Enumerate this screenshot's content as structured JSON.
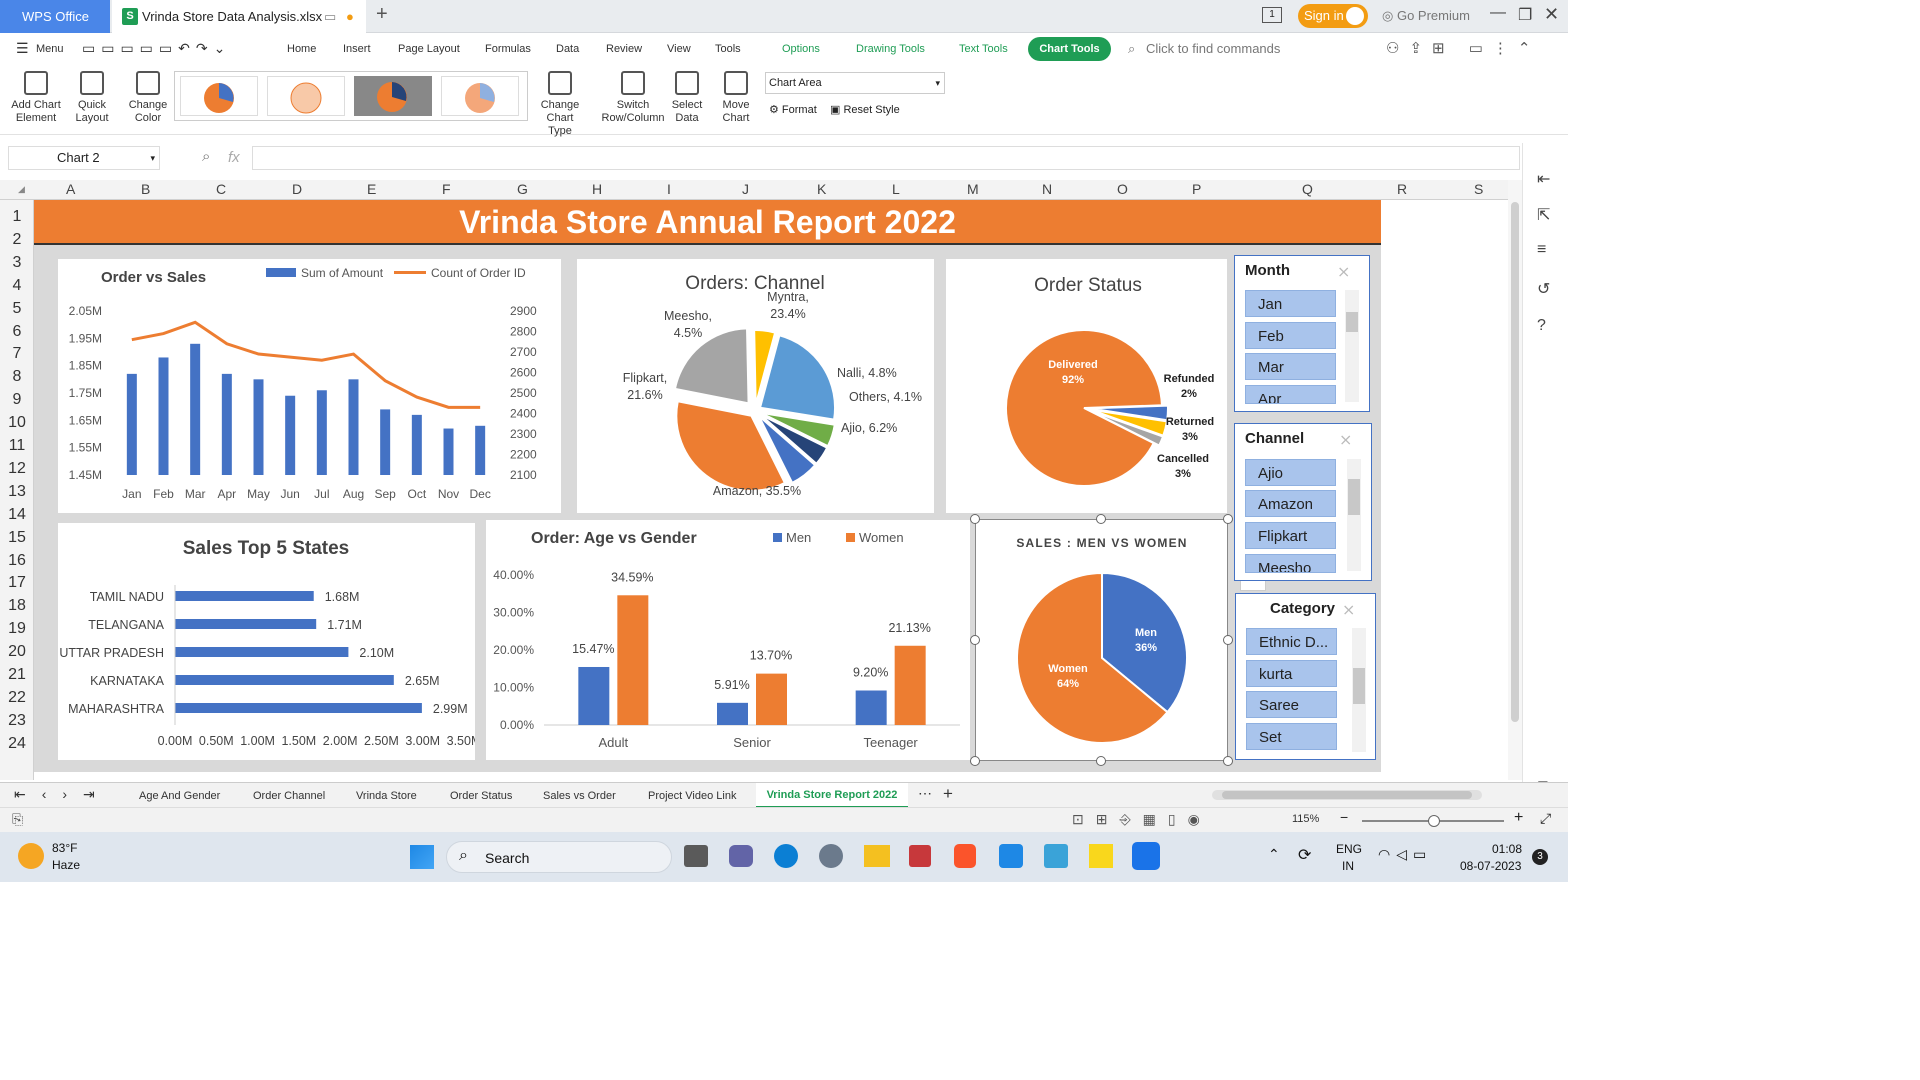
{
  "titlebar": {
    "app": "WPS Office",
    "file": "Vrinda Store Data Analysis.xlsx",
    "sign_in": "Sign in",
    "premium": "Go Premium"
  },
  "menu": {
    "menu_label": "Menu",
    "items": [
      "Home",
      "Insert",
      "Page Layout",
      "Formulas",
      "Data",
      "Review",
      "View",
      "Tools"
    ],
    "ctx": [
      "Options",
      "Drawing Tools",
      "Text Tools"
    ],
    "active": "Chart Tools",
    "search": "Click to find commands"
  },
  "ribbon": {
    "add_chart_element": "Add Chart Element",
    "quick_layout": "Quick Layout",
    "change_color": "Change Color",
    "change_chart_type": "Change Chart Type",
    "switch_row_col": "Switch Row/Column",
    "select_data": "Select Data",
    "move_chart": "Move Chart",
    "chart_area_select": "Chart Area",
    "format": "Format",
    "reset_style": "Reset Style"
  },
  "formula_bar": {
    "name_box": "Chart 2",
    "fx": "fx",
    "value": ""
  },
  "columns": [
    "A",
    "B",
    "C",
    "D",
    "E",
    "F",
    "G",
    "H",
    "I",
    "J",
    "K",
    "L",
    "M",
    "N",
    "O",
    "P",
    "Q",
    "R",
    "S"
  ],
  "rows": [
    "1",
    "2",
    "3",
    "4",
    "5",
    "6",
    "7",
    "8",
    "9",
    "10",
    "11",
    "12",
    "13",
    "14",
    "15",
    "16",
    "17",
    "18",
    "19",
    "20",
    "21",
    "22",
    "23",
    "24"
  ],
  "dashboard": {
    "title": "Vrinda Store Annual Report 2022"
  },
  "chart_data": [
    {
      "type": "bar+line",
      "title": "Order vs Sales",
      "categories": [
        "Jan",
        "Feb",
        "Mar",
        "Apr",
        "May",
        "Jun",
        "Jul",
        "Aug",
        "Sep",
        "Oct",
        "Nov",
        "Dec"
      ],
      "series": [
        {
          "name": "Sum of Amount",
          "type": "bar",
          "axis": "left",
          "color": "#4472c4",
          "values": [
            1.82,
            1.88,
            1.93,
            1.82,
            1.8,
            1.74,
            1.76,
            1.8,
            1.69,
            1.67,
            1.62,
            1.63
          ]
        },
        {
          "name": "Count of Order ID",
          "type": "line",
          "axis": "right",
          "color": "#ed7d31",
          "values": [
            2760,
            2790,
            2845,
            2740,
            2690,
            2675,
            2660,
            2690,
            2560,
            2480,
            2430,
            2430
          ]
        }
      ],
      "left_ticks": [
        "2.05M",
        "1.95M",
        "1.85M",
        "1.75M",
        "1.65M",
        "1.55M",
        "1.45M"
      ],
      "right_ticks": [
        "2900",
        "2800",
        "2700",
        "2600",
        "2500",
        "2400",
        "2300",
        "2200",
        "2100"
      ],
      "ylim_left": [
        1.45,
        2.05
      ],
      "ylim_right": [
        2100,
        2900
      ]
    },
    {
      "type": "pie",
      "title": "Orders: Channel",
      "slices": [
        {
          "label": "Myntra",
          "value": 23.4,
          "pct": "23.4%",
          "color": "#5b9bd5"
        },
        {
          "label": "Nalli",
          "value": 4.8,
          "pct": "4.8%",
          "color": "#70ad47"
        },
        {
          "label": "Others",
          "value": 4.1,
          "pct": "4.1%",
          "color": "#264478"
        },
        {
          "label": "Ajio",
          "value": 6.2,
          "pct": "6.2%",
          "color": "#4472c4"
        },
        {
          "label": "Amazon",
          "value": 35.5,
          "pct": "35.5%",
          "color": "#ed7d31"
        },
        {
          "label": "Flipkart",
          "value": 21.6,
          "pct": "21.6%",
          "color": "#a5a5a5"
        },
        {
          "label": "Meesho",
          "value": 4.5,
          "pct": "4.5%",
          "color": "#ffc000"
        }
      ]
    },
    {
      "type": "pie",
      "title": "Order Status",
      "slices": [
        {
          "label": "Delivered",
          "value": 92,
          "pct": "92%",
          "color": "#ed7d31"
        },
        {
          "label": "Cancelled",
          "value": 3,
          "pct": "3%",
          "color": "#4472c4"
        },
        {
          "label": "Returned",
          "value": 3,
          "pct": "3%",
          "color": "#ffc000"
        },
        {
          "label": "Refunded",
          "value": 2,
          "pct": "2%",
          "color": "#a5a5a5"
        }
      ]
    },
    {
      "type": "bar",
      "orientation": "horizontal",
      "title": "Sales Top 5 States",
      "categories": [
        "TAMIL NADU",
        "TELANGANA",
        "UTTAR PRADESH",
        "KARNATAKA",
        "MAHARASHTRA"
      ],
      "values": [
        1.68,
        1.71,
        2.1,
        2.65,
        2.99
      ],
      "labels": [
        "1.68M",
        "1.71M",
        "2.10M",
        "2.65M",
        "2.99M"
      ],
      "x_ticks": [
        "0.00M",
        "0.50M",
        "1.00M",
        "1.50M",
        "2.00M",
        "2.50M",
        "3.00M",
        "3.50M"
      ],
      "xlim": [
        0,
        3.5
      ],
      "color": "#4472c4"
    },
    {
      "type": "bar",
      "title": "Order: Age vs Gender",
      "categories": [
        "Adult",
        "Senior",
        "Teenager"
      ],
      "series": [
        {
          "name": "Men",
          "color": "#4472c4",
          "values": [
            15.47,
            5.91,
            9.2
          ],
          "labels": [
            "15.47%",
            "5.91%",
            "9.20%"
          ]
        },
        {
          "name": "Women",
          "color": "#ed7d31",
          "values": [
            34.59,
            13.7,
            21.13
          ],
          "labels": [
            "34.59%",
            "13.70%",
            "21.13%"
          ]
        }
      ],
      "y_ticks": [
        "40.00%",
        "30.00%",
        "20.00%",
        "10.00%",
        "0.00%"
      ],
      "ylim": [
        0,
        40
      ]
    },
    {
      "type": "pie",
      "title": "SALES : MEN VS WOMEN",
      "slices": [
        {
          "label": "Men",
          "value": 36,
          "pct": "36%",
          "color": "#4472c4"
        },
        {
          "label": "Women",
          "value": 64,
          "pct": "64%",
          "color": "#ed7d31"
        }
      ]
    }
  ],
  "slicers": {
    "month": {
      "title": "Month",
      "items": [
        "Jan",
        "Feb",
        "Mar",
        "Apr"
      ]
    },
    "channel": {
      "title": "Channel",
      "items": [
        "Ajio",
        "Amazon",
        "Flipkart",
        "Meesho"
      ]
    },
    "category": {
      "title": "Category",
      "items": [
        "Ethnic D...",
        "kurta",
        "Saree",
        "Set"
      ]
    }
  },
  "sheet_tabs": [
    "Age And Gender",
    "Order Channel",
    "Vrinda Store",
    "Order Status",
    "Sales vs Order",
    "Project Video Link",
    "Vrinda Store Report 2022"
  ],
  "active_sheet": "Vrinda Store Report 2022",
  "status": {
    "zoom": "115%"
  },
  "taskbar": {
    "temp": "83°F",
    "weather": "Haze",
    "search": "Search",
    "lang1": "ENG",
    "lang2": "IN",
    "time": "01:08",
    "date": "08-07-2023",
    "notif": "3"
  }
}
